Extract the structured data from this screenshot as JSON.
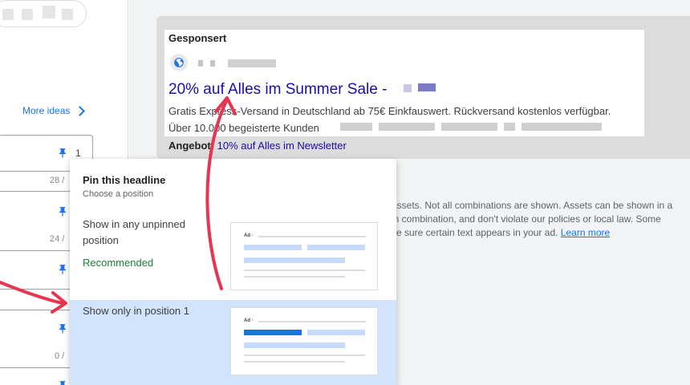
{
  "sidebar": {
    "more_ideas_label": "More ideas",
    "fields": [
      {
        "pin_number": "1",
        "char_count": "28 /"
      },
      {
        "pin_number": "",
        "char_count": "24 /"
      },
      {
        "pin_number": "",
        "char_count": ""
      },
      {
        "pin_number": "",
        "char_count": "0 /"
      }
    ]
  },
  "ad_preview": {
    "sponsored_label": "Gesponsert",
    "headline": "20% auf Alles im Summer Sale -",
    "description": "Gratis Express-Versand in Deutschland ab 75€ Einkfauswert. Rückversand kostenlos verfügbar.",
    "reviews_text": "Über 10.000 begeisterte Kunden",
    "sitelink_label": "Angebot:",
    "sitelink_text": "10% auf Alles im Newsletter"
  },
  "disclaimer": {
    "line1": "assets. Not all combinations are shown. Assets can be shown in a",
    "line2": "in combination, and don't violate our policies or local law. Some",
    "line3_prefix": "ke sure certain text appears in your ad.",
    "learn_more": "Learn more"
  },
  "pin_popup": {
    "title": "Pin this headline",
    "subtitle": "Choose a position",
    "option_any_label": "Show in any unpinned position",
    "option_any_badge": "Recommended",
    "option_pos1_label": "Show only in position 1",
    "thumbnail_ad_label": "Ad ·"
  },
  "colors": {
    "link_blue": "#1a0dab",
    "accent_blue": "#1a73e8",
    "selected_bg": "#d2e3fc",
    "recommended_green": "#188038",
    "arrow_red": "#e8344e"
  }
}
